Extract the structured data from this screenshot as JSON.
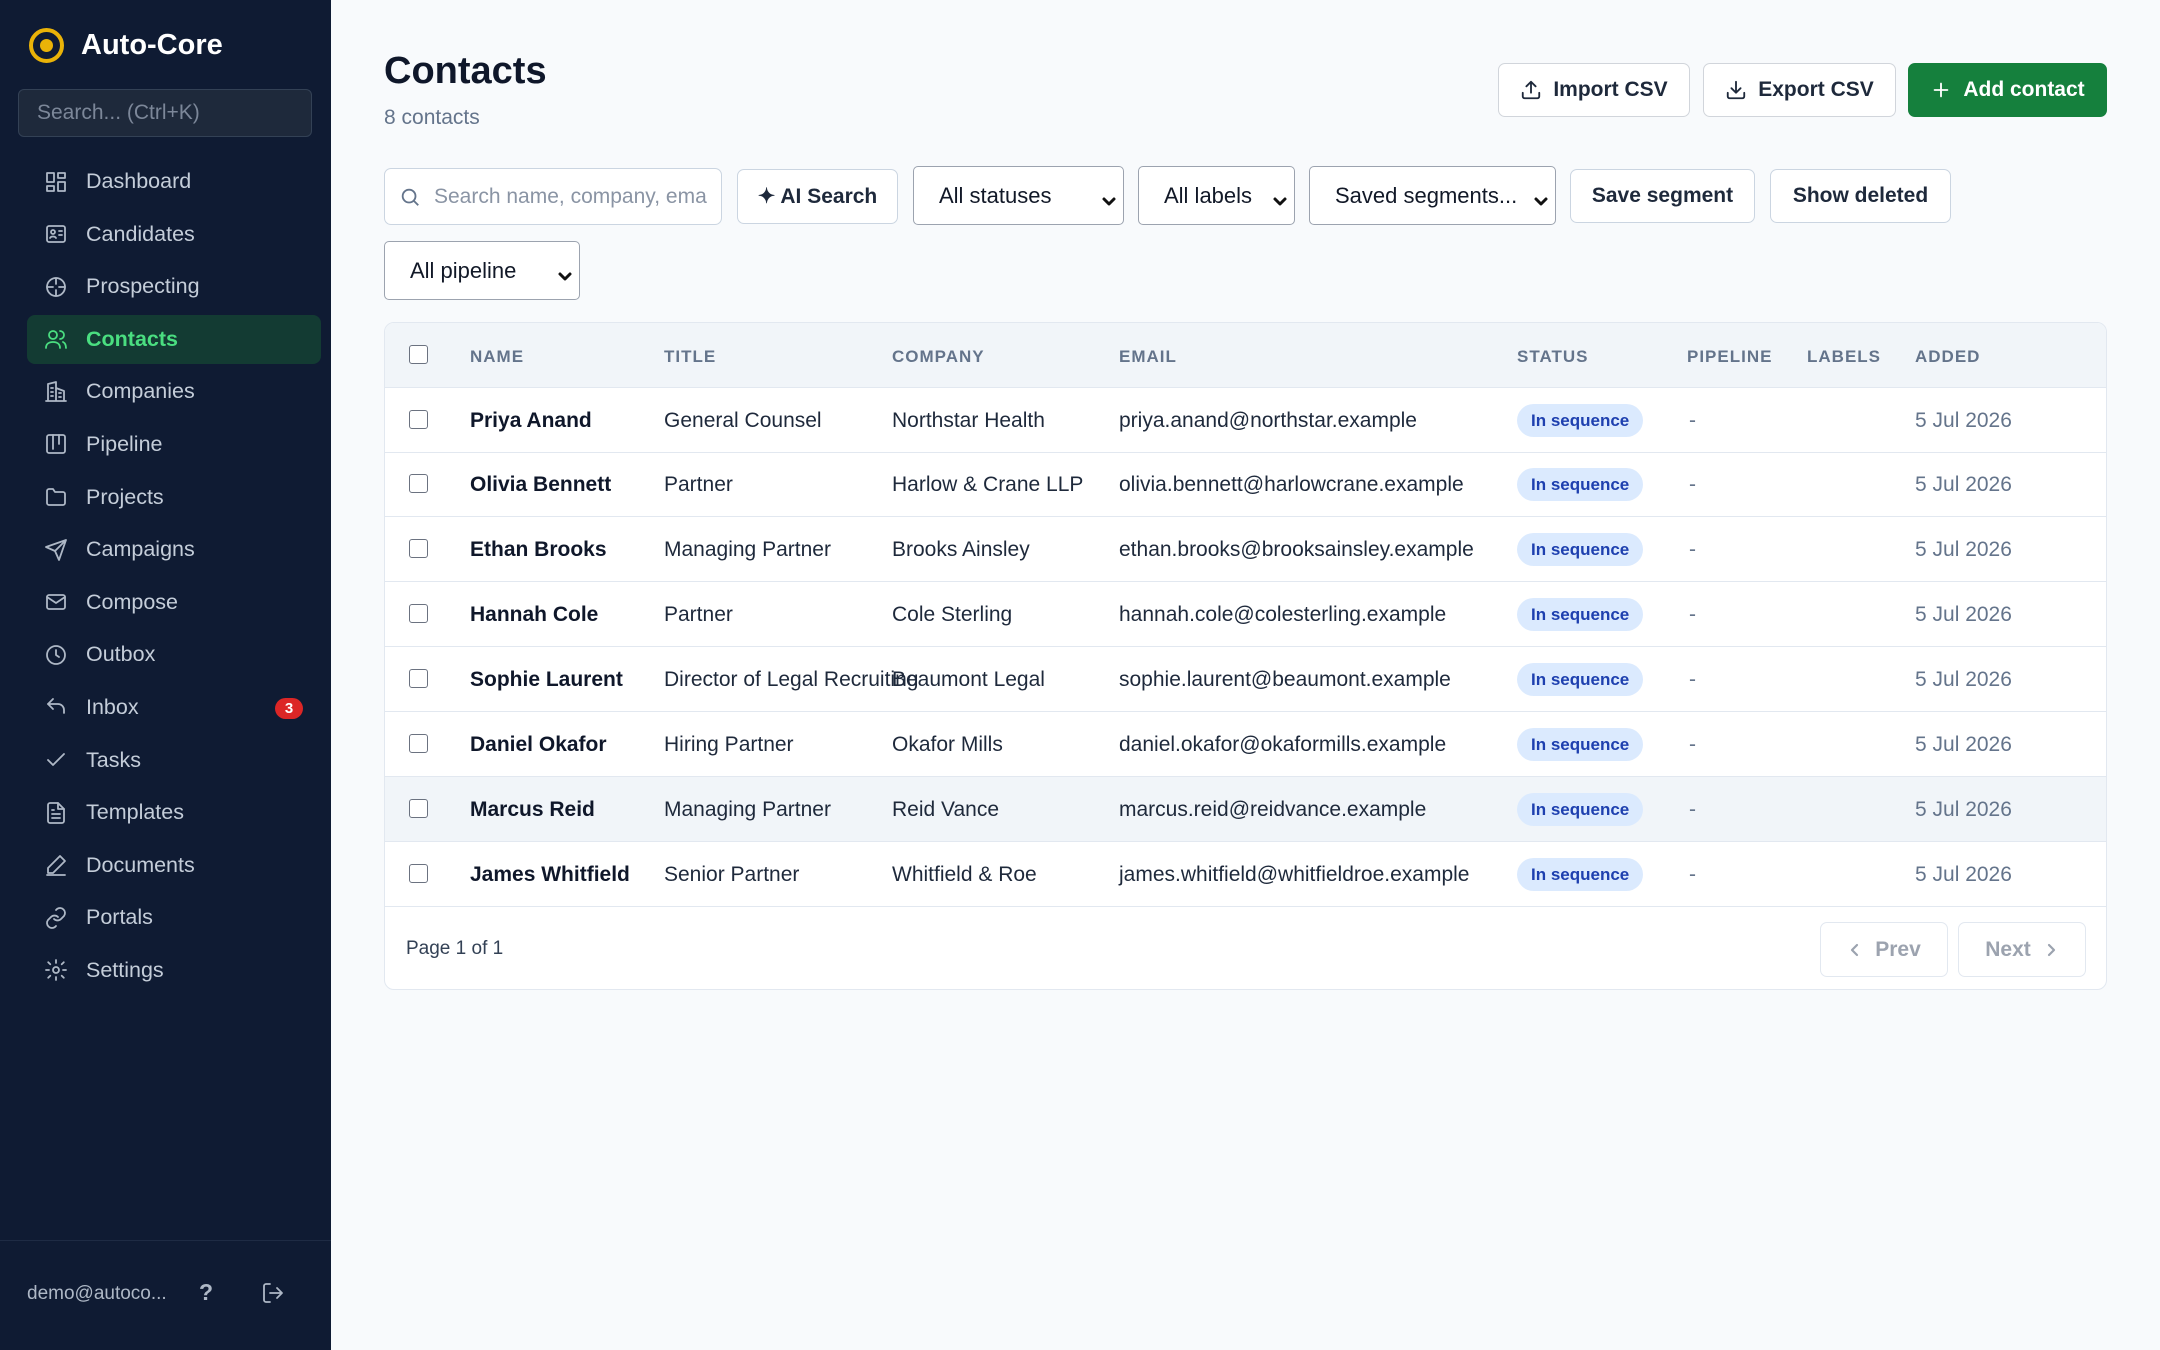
{
  "app": {
    "name": "Auto-Core",
    "search_placeholder": "Search... (Ctrl+K)"
  },
  "sidebar": {
    "items": [
      {
        "label": "Dashboard",
        "icon": "dashboard-icon"
      },
      {
        "label": "Candidates",
        "icon": "id-card-icon"
      },
      {
        "label": "Prospecting",
        "icon": "crosshair-icon"
      },
      {
        "label": "Contacts",
        "icon": "users-icon",
        "active": true
      },
      {
        "label": "Companies",
        "icon": "building-icon"
      },
      {
        "label": "Pipeline",
        "icon": "kanban-icon"
      },
      {
        "label": "Projects",
        "icon": "folder-icon"
      },
      {
        "label": "Campaigns",
        "icon": "send-icon"
      },
      {
        "label": "Compose",
        "icon": "mail-icon"
      },
      {
        "label": "Outbox",
        "icon": "clock-icon"
      },
      {
        "label": "Inbox",
        "icon": "reply-icon",
        "badge": "3"
      },
      {
        "label": "Tasks",
        "icon": "check-icon"
      },
      {
        "label": "Templates",
        "icon": "file-text-icon"
      },
      {
        "label": "Documents",
        "icon": "signature-icon"
      },
      {
        "label": "Portals",
        "icon": "link-icon"
      },
      {
        "label": "Settings",
        "icon": "gear-icon"
      }
    ],
    "footer": {
      "user": "demo@autoco...",
      "help": "?"
    }
  },
  "header": {
    "title": "Contacts",
    "subtitle": "8 contacts",
    "import_label": "Import CSV",
    "export_label": "Export CSV",
    "add_label": "Add contact"
  },
  "filters": {
    "search_placeholder": "Search name, company, email...",
    "search_visible": "Search name, company, ema",
    "ai_search_label": "✦ AI Search",
    "status_selected": "All statuses",
    "labels_selected": "All labels",
    "segments_selected": "Saved segments...",
    "save_segment_label": "Save segment",
    "show_deleted_label": "Show deleted",
    "pipeline_selected": "All pipeline"
  },
  "table": {
    "columns": [
      "NAME",
      "TITLE",
      "COMPANY",
      "EMAIL",
      "STATUS",
      "PIPELINE",
      "LABELS",
      "ADDED"
    ],
    "rows": [
      {
        "name": "Priya Anand",
        "title": "General Counsel",
        "company": "Northstar Health",
        "email": "priya.anand@northstar.example",
        "status": "In sequence",
        "pipeline": "-",
        "labels": "",
        "added": "5 Jul 2026"
      },
      {
        "name": "Olivia Bennett",
        "title": "Partner",
        "company": "Harlow & Crane LLP",
        "email": "olivia.bennett@harlowcrane.example",
        "status": "In sequence",
        "pipeline": "-",
        "labels": "",
        "added": "5 Jul 2026"
      },
      {
        "name": "Ethan Brooks",
        "title": "Managing Partner",
        "company": "Brooks Ainsley",
        "email": "ethan.brooks@brooksainsley.example",
        "status": "In sequence",
        "pipeline": "-",
        "labels": "",
        "added": "5 Jul 2026"
      },
      {
        "name": "Hannah Cole",
        "title": "Partner",
        "company": "Cole Sterling",
        "email": "hannah.cole@colesterling.example",
        "status": "In sequence",
        "pipeline": "-",
        "labels": "",
        "added": "5 Jul 2026"
      },
      {
        "name": "Sophie Laurent",
        "title": "Director of Legal Recruiting",
        "company": "Beaumont Legal",
        "email": "sophie.laurent@beaumont.example",
        "status": "In sequence",
        "pipeline": "-",
        "labels": "",
        "added": "5 Jul 2026"
      },
      {
        "name": "Daniel Okafor",
        "title": "Hiring Partner",
        "company": "Okafor Mills",
        "email": "daniel.okafor@okaformills.example",
        "status": "In sequence",
        "pipeline": "-",
        "labels": "",
        "added": "5 Jul 2026"
      },
      {
        "name": "Marcus Reid",
        "title": "Managing Partner",
        "company": "Reid Vance",
        "email": "marcus.reid@reidvance.example",
        "status": "In sequence",
        "pipeline": "-",
        "labels": "",
        "added": "5 Jul 2026"
      },
      {
        "name": "James Whitfield",
        "title": "Senior Partner",
        "company": "Whitfield & Roe",
        "email": "james.whitfield@whitfieldroe.example",
        "status": "In sequence",
        "pipeline": "-",
        "labels": "",
        "added": "5 Jul 2026"
      }
    ],
    "page_info": "Page 1 of 1",
    "prev_label": "Prev",
    "next_label": "Next"
  },
  "colors": {
    "sidebar_bg": "#0f1b33",
    "accent": "#15803d",
    "active_nav_text": "#4ade80",
    "brand_logo": "#eab308",
    "status_badge_bg": "#dbeafe",
    "status_badge_text": "#1e40af",
    "inbox_badge": "#dc2626"
  }
}
